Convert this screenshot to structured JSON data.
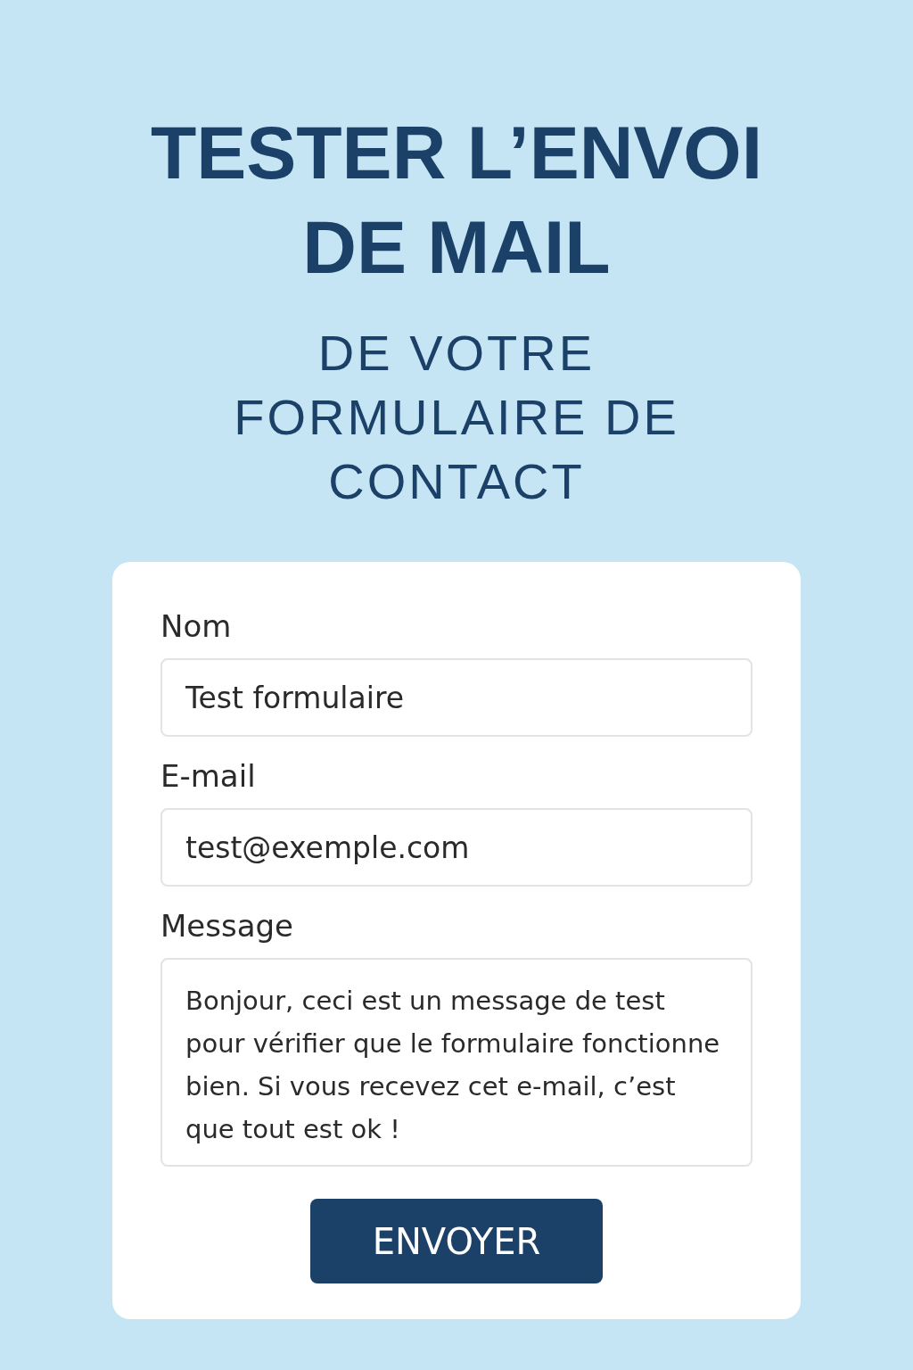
{
  "title": "TESTER L’ENVOI DE MAIL",
  "subtitle": "DE VOTRE FORMULAIRE DE CONTACT",
  "form": {
    "fields": [
      {
        "kind": "input",
        "label": "Nom",
        "value": "Test formulaire"
      },
      {
        "kind": "input",
        "label": "E-mail",
        "value": "test@exemple.com"
      },
      {
        "kind": "textarea",
        "label": "Message",
        "value": "Bonjour, ceci est un message de test pour vérifier que le formulaire fonctionne bien. Si vous recevez cet e-mail, c’est que tout est ok !"
      }
    ],
    "submit": "ENVOYER"
  }
}
